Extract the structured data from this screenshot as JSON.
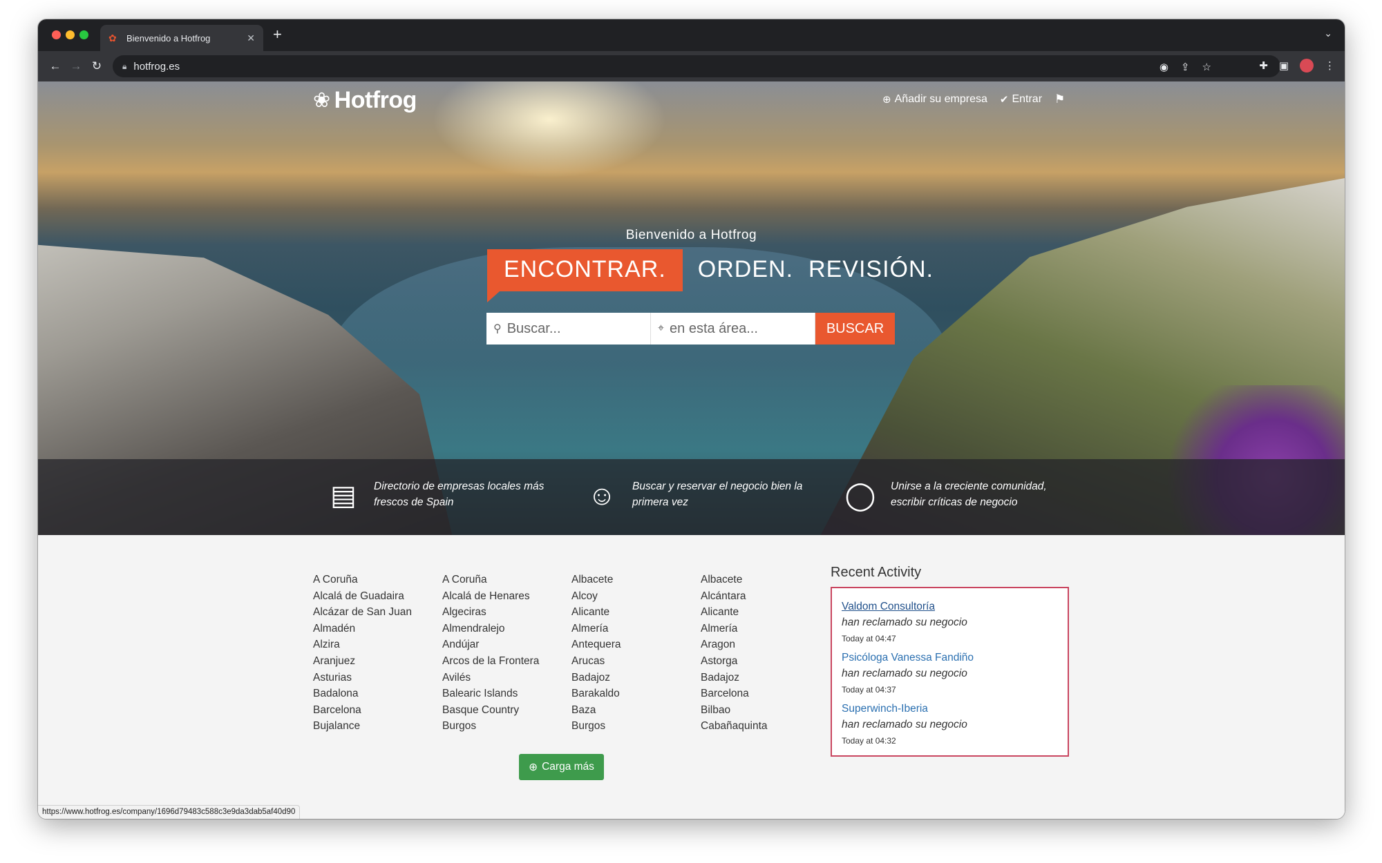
{
  "browser": {
    "tab_title": "Bienvenido a Hotfrog",
    "url": "hotfrog.es",
    "status_url": "https://www.hotfrog.es/company/1696d79483c588c3e9da3dab5af40d90"
  },
  "header": {
    "logo": "Hotfrog",
    "add_business": "Añadir su empresa",
    "login": "Entrar"
  },
  "hero": {
    "welcome": "Bienvenido a Hotfrog",
    "tag_find": "ENCONTRAR.",
    "tag_order": "ORDEN.",
    "tag_review": "REVISIÓN.",
    "search_placeholder": "Buscar...",
    "location_placeholder": "en esta área...",
    "search_button": "BUSCAR"
  },
  "features": [
    {
      "text": "Directorio de empresas locales más frescos de Spain",
      "icon": "id-card-icon"
    },
    {
      "text": "Buscar y reservar el negocio bien la primera vez",
      "icon": "user-icon"
    },
    {
      "text": "Unirse a la creciente comunidad, escribir críticas de negocio",
      "icon": "chat-bubble-icon"
    }
  ],
  "locations": {
    "col1": [
      "A Coruña",
      "Alcalá de Guadaira",
      "Alcázar de San Juan",
      "Almadén",
      "Alzira",
      "Aranjuez",
      "Asturias",
      "Badalona",
      "Barcelona",
      "Bujalance"
    ],
    "col2": [
      "A Coruña",
      "Alcalá de Henares",
      "Algeciras",
      "Almendralejo",
      "Andújar",
      "Arcos de la Frontera",
      "Avilés",
      "Balearic Islands",
      "Basque Country",
      "Burgos"
    ],
    "col3": [
      "Albacete",
      "Alcoy",
      "Alicante",
      "Almería",
      "Antequera",
      "Arucas",
      "Badajoz",
      "Barakaldo",
      "Baza",
      "Burgos"
    ],
    "col4": [
      "Albacete",
      "Alcántara",
      "Alicante",
      "Almería",
      "Aragon",
      "Astorga",
      "Badajoz",
      "Barcelona",
      "Bilbao",
      "Cabañaquinta"
    ]
  },
  "load_more": "Carga más",
  "activity": {
    "title": "Recent Activity",
    "items": [
      {
        "name": "Valdom Consultoría",
        "desc": "han reclamado su negocio",
        "time": "Today at 04:47"
      },
      {
        "name": "Psicóloga Vanessa Fandiño",
        "desc": "han reclamado su negocio",
        "time": "Today at 04:37"
      },
      {
        "name": "Superwinch-Iberia",
        "desc": "han reclamado su negocio",
        "time": "Today at 04:32"
      }
    ]
  }
}
